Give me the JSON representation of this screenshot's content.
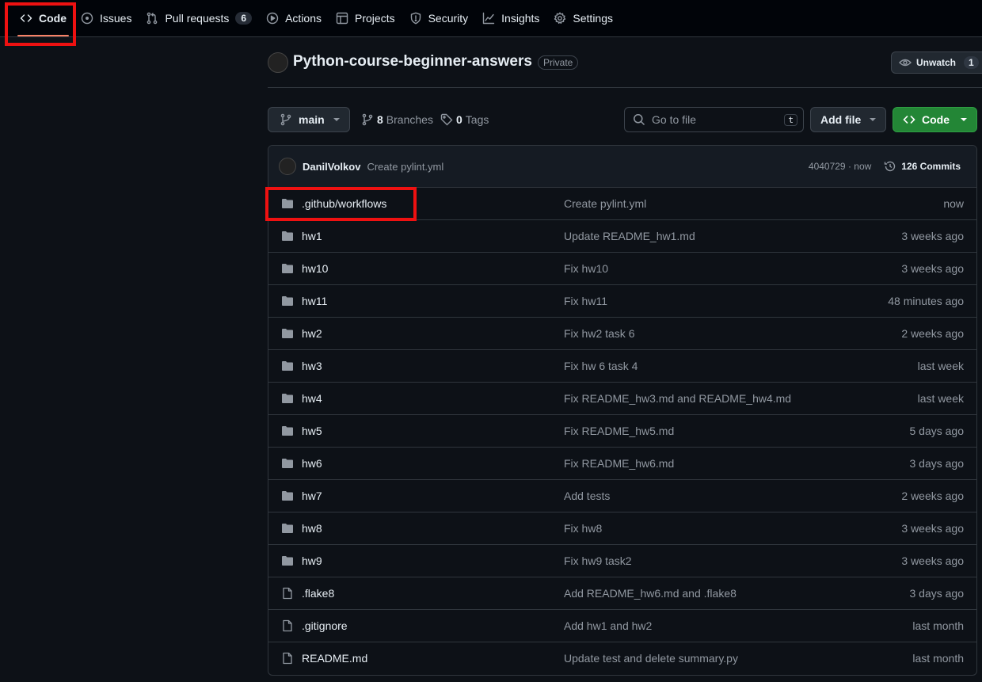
{
  "nav": {
    "tabs": [
      {
        "label": "Code",
        "icon": "code-icon"
      },
      {
        "label": "Issues",
        "icon": "issue-icon"
      },
      {
        "label": "Pull requests",
        "icon": "pull-request-icon",
        "count": "6"
      },
      {
        "label": "Actions",
        "icon": "play-icon"
      },
      {
        "label": "Projects",
        "icon": "table-icon"
      },
      {
        "label": "Security",
        "icon": "shield-icon"
      },
      {
        "label": "Insights",
        "icon": "graph-icon"
      },
      {
        "label": "Settings",
        "icon": "gear-icon"
      }
    ]
  },
  "repo": {
    "name": "Python-course-beginner-answers",
    "visibility": "Private",
    "watch_label": "Unwatch",
    "watch_count": "1"
  },
  "toolbar": {
    "branch": "main",
    "branches_count": "8",
    "branches_label": "Branches",
    "tags_count": "0",
    "tags_label": "Tags",
    "search_placeholder": "Go to file",
    "search_shortcut": "t",
    "add_file_label": "Add file",
    "code_label": "Code"
  },
  "latest_commit": {
    "author": "DanilVolkov",
    "message": "Create pylint.yml",
    "sha_time": "4040729 · now",
    "commits_count": "126 Commits"
  },
  "files": [
    {
      "type": "dir",
      "name": ".github/workflows",
      "message": "Create pylint.yml",
      "date": "now"
    },
    {
      "type": "dir",
      "name": "hw1",
      "message": "Update README_hw1.md",
      "date": "3 weeks ago"
    },
    {
      "type": "dir",
      "name": "hw10",
      "message": "Fix hw10",
      "date": "3 weeks ago"
    },
    {
      "type": "dir",
      "name": "hw11",
      "message": "Fix hw11",
      "date": "48 minutes ago"
    },
    {
      "type": "dir",
      "name": "hw2",
      "message": "Fix hw2 task 6",
      "date": "2 weeks ago"
    },
    {
      "type": "dir",
      "name": "hw3",
      "message": "Fix hw 6 task 4",
      "date": "last week"
    },
    {
      "type": "dir",
      "name": "hw4",
      "message": "Fix README_hw3.md and README_hw4.md",
      "date": "last week"
    },
    {
      "type": "dir",
      "name": "hw5",
      "message": "Fix README_hw5.md",
      "date": "5 days ago"
    },
    {
      "type": "dir",
      "name": "hw6",
      "message": "Fix README_hw6.md",
      "date": "3 days ago"
    },
    {
      "type": "dir",
      "name": "hw7",
      "message": "Add tests",
      "date": "2 weeks ago"
    },
    {
      "type": "dir",
      "name": "hw8",
      "message": "Fix hw8",
      "date": "3 weeks ago"
    },
    {
      "type": "dir",
      "name": "hw9",
      "message": "Fix hw9 task2",
      "date": "3 weeks ago"
    },
    {
      "type": "file",
      "name": ".flake8",
      "message": "Add README_hw6.md and .flake8",
      "date": "3 days ago"
    },
    {
      "type": "file",
      "name": ".gitignore",
      "message": "Add hw1 and hw2",
      "date": "last month"
    },
    {
      "type": "file",
      "name": "README.md",
      "message": "Update test and delete summary.py",
      "date": "last month"
    }
  ],
  "colors": {
    "background": "#0d1117",
    "accent_underline": "#f78166",
    "code_button": "#238636",
    "highlight_box": "#ee1111"
  }
}
